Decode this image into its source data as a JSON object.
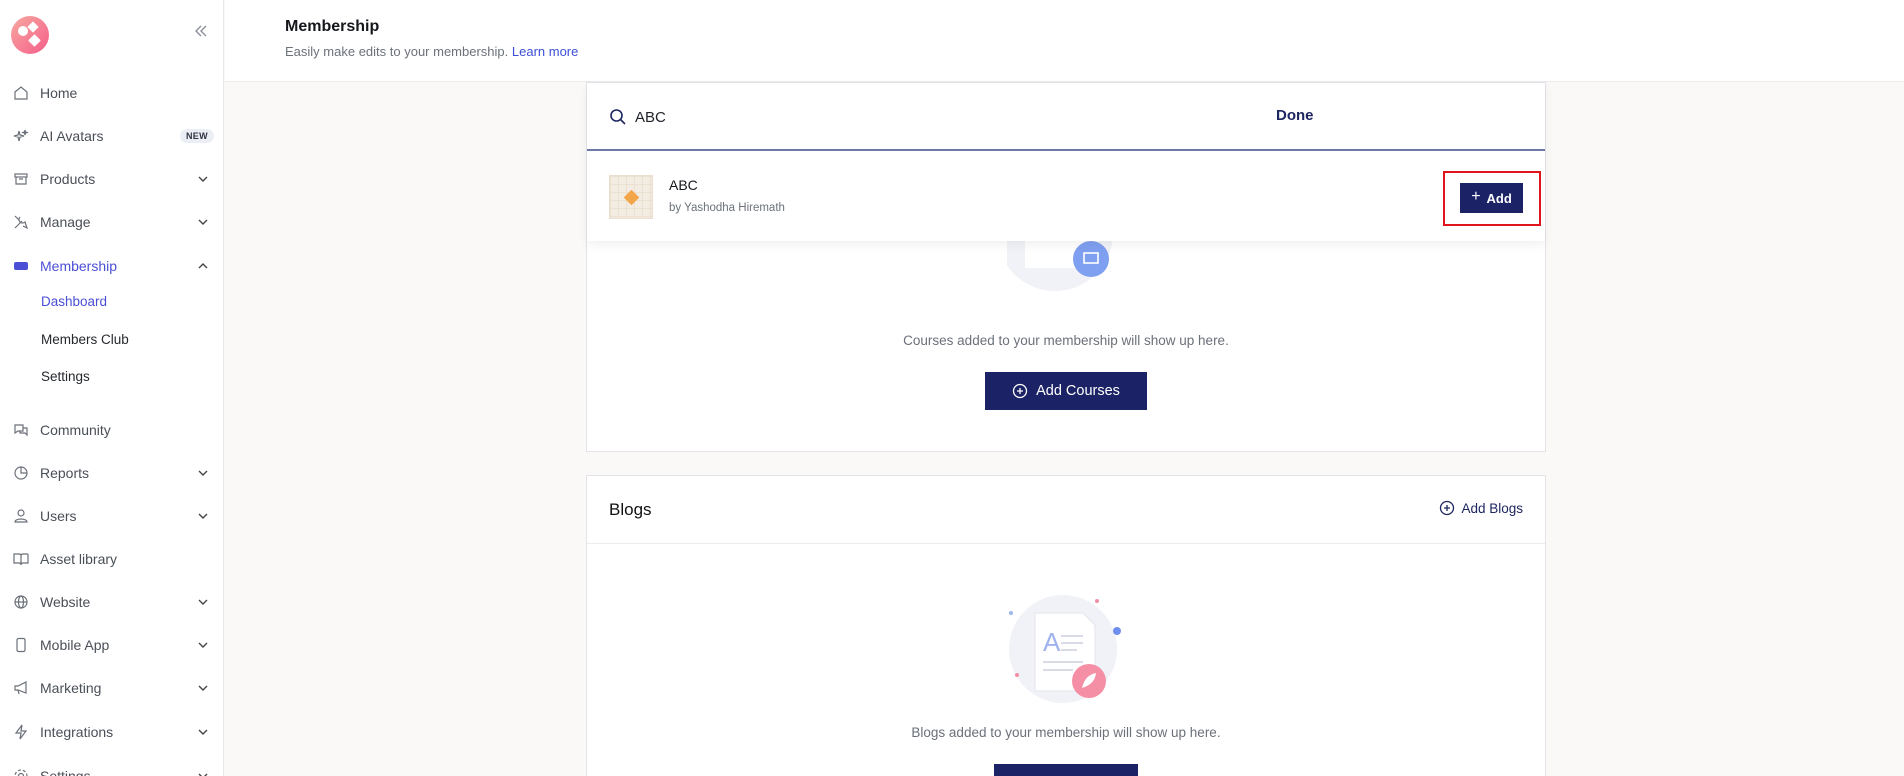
{
  "sidebar": {
    "items": [
      {
        "label": "Home"
      },
      {
        "label": "AI Avatars",
        "badge": "NEW"
      },
      {
        "label": "Products"
      },
      {
        "label": "Manage"
      },
      {
        "label": "Membership"
      },
      {
        "label": "Community"
      },
      {
        "label": "Reports"
      },
      {
        "label": "Users"
      },
      {
        "label": "Asset library"
      },
      {
        "label": "Website"
      },
      {
        "label": "Mobile App"
      },
      {
        "label": "Marketing"
      },
      {
        "label": "Integrations"
      },
      {
        "label": "Settings"
      }
    ],
    "membership_sub": [
      {
        "label": "Dashboard"
      },
      {
        "label": "Members Club"
      },
      {
        "label": "Settings"
      }
    ]
  },
  "header": {
    "title": "Membership",
    "subtitle": "Easily make edits to your membership.",
    "learn_more": "Learn more"
  },
  "search": {
    "value": "ABC",
    "done_label": "Done",
    "result": {
      "title": "ABC",
      "author": "by Yashodha Hiremath",
      "add_label": "Add"
    }
  },
  "courses": {
    "empty_text": "Courses added to your membership will show up here.",
    "add_label": "Add Courses"
  },
  "blogs": {
    "title": "Blogs",
    "add_link": "Add Blogs",
    "empty_text": "Blogs added to your membership will show up here."
  },
  "colors": {
    "primary": "#1b2366",
    "accent": "#4b4fd6",
    "highlight": "#e0151b"
  }
}
